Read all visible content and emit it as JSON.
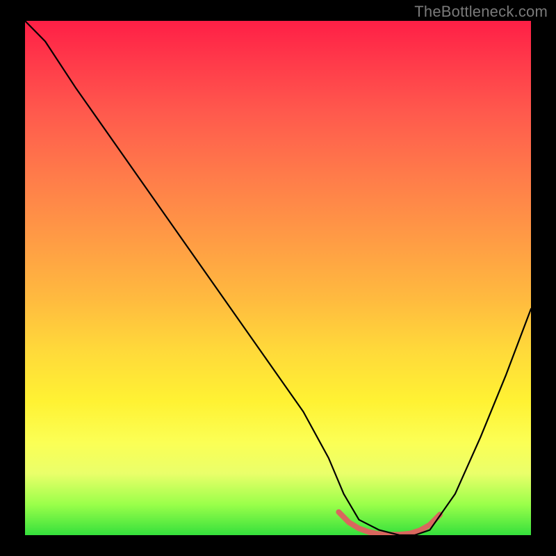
{
  "watermark": "TheBottleneck.com",
  "colors": {
    "background": "#000000",
    "gradient_top": "#ff1f46",
    "gradient_mid1": "#ff9a45",
    "gradient_mid2": "#fff233",
    "gradient_bottom": "#35e03c",
    "curve": "#000000",
    "highlight": "#d9675e"
  },
  "chart_data": {
    "type": "line",
    "title": "",
    "xlabel": "",
    "ylabel": "",
    "xlim": [
      0,
      100
    ],
    "ylim": [
      0,
      100
    ],
    "grid": false,
    "series": [
      {
        "name": "bottleneck-curve",
        "x": [
          0,
          4,
          10,
          20,
          30,
          40,
          50,
          55,
          60,
          63,
          66,
          70,
          74,
          77,
          80,
          85,
          90,
          95,
          100
        ],
        "values": [
          100,
          96,
          87,
          73,
          59,
          45,
          31,
          24,
          15,
          8,
          3,
          1,
          0,
          0,
          1,
          8,
          19,
          31,
          44
        ]
      }
    ],
    "annotations": [
      {
        "name": "bottom-highlight-segment",
        "type": "path",
        "stroke": "#d9675e",
        "stroke_width_px": 8,
        "x": [
          62,
          64,
          66,
          68,
          70,
          72,
          74,
          76,
          78,
          80,
          82
        ],
        "values": [
          4.5,
          2.5,
          1.3,
          0.6,
          0.2,
          0.1,
          0.1,
          0.3,
          0.9,
          2.0,
          4.0
        ]
      }
    ]
  }
}
